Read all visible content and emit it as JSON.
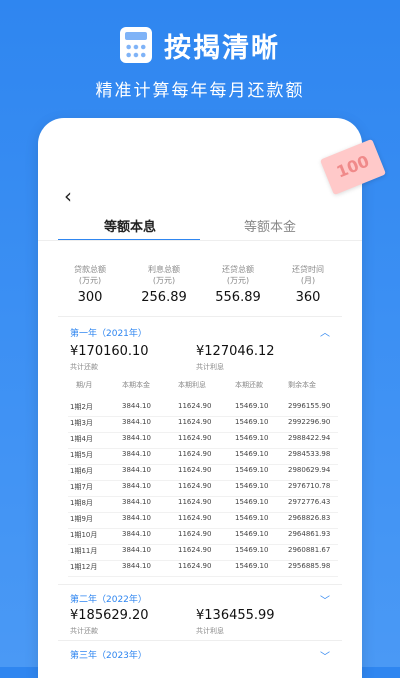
{
  "promo": {
    "title": "按揭清晰",
    "subtitle": "精准计算每年每月还款额",
    "banknote_text": "100",
    "calculator_icon": "calculator-icon"
  },
  "nav": {
    "back_icon": "back-arrow-icon",
    "back_glyph": "‹"
  },
  "tabs": {
    "equal_principal_interest": "等额本息",
    "equal_principal": "等额本金",
    "active": "equal_principal_interest"
  },
  "summary": [
    {
      "label_line1": "贷款总额",
      "label_line2": "(万元)",
      "value": "300"
    },
    {
      "label_line1": "利息总额",
      "label_line2": "(万元)",
      "value": "256.89"
    },
    {
      "label_line1": "还贷总额",
      "label_line2": "(万元)",
      "value": "556.89"
    },
    {
      "label_line1": "还贷时间",
      "label_line2": "(月)",
      "value": "360"
    }
  ],
  "year1": {
    "title": "第一年（2021年）",
    "expanded": true,
    "total_payment": "¥170160.10",
    "total_payment_label": "共计还款",
    "total_interest": "¥127046.12",
    "total_interest_label": "共计利息",
    "columns": [
      "期/月",
      "本期本金",
      "本期利息",
      "本期还款",
      "剩余本金"
    ],
    "rows": [
      [
        "1期2月",
        "3844.10",
        "11624.90",
        "15469.10",
        "2996155.90"
      ],
      [
        "1期3月",
        "3844.10",
        "11624.90",
        "15469.10",
        "2992296.90"
      ],
      [
        "1期4月",
        "3844.10",
        "11624.90",
        "15469.10",
        "2988422.94"
      ],
      [
        "1期5月",
        "3844.10",
        "11624.90",
        "15469.10",
        "2984533.98"
      ],
      [
        "1期6月",
        "3844.10",
        "11624.90",
        "15469.10",
        "2980629.94"
      ],
      [
        "1期7月",
        "3844.10",
        "11624.90",
        "15469.10",
        "2976710.78"
      ],
      [
        "1期8月",
        "3844.10",
        "11624.90",
        "15469.10",
        "2972776.43"
      ],
      [
        "1期9月",
        "3844.10",
        "11624.90",
        "15469.10",
        "2968826.83"
      ],
      [
        "1期10月",
        "3844.10",
        "11624.90",
        "15469.10",
        "2964861.93"
      ],
      [
        "1期11月",
        "3844.10",
        "11624.90",
        "15469.10",
        "2960881.67"
      ],
      [
        "1期12月",
        "3844.10",
        "11624.90",
        "15469.10",
        "2956885.98"
      ]
    ]
  },
  "year2": {
    "title": "第二年（2022年）",
    "expanded": false,
    "total_payment": "¥185629.20",
    "total_payment_label": "共计还款",
    "total_interest": "¥136455.99",
    "total_interest_label": "共计利息"
  },
  "year3": {
    "title": "第三年（2023年）",
    "expanded": false
  },
  "chevron_up": "︿",
  "chevron_down": "﹀"
}
